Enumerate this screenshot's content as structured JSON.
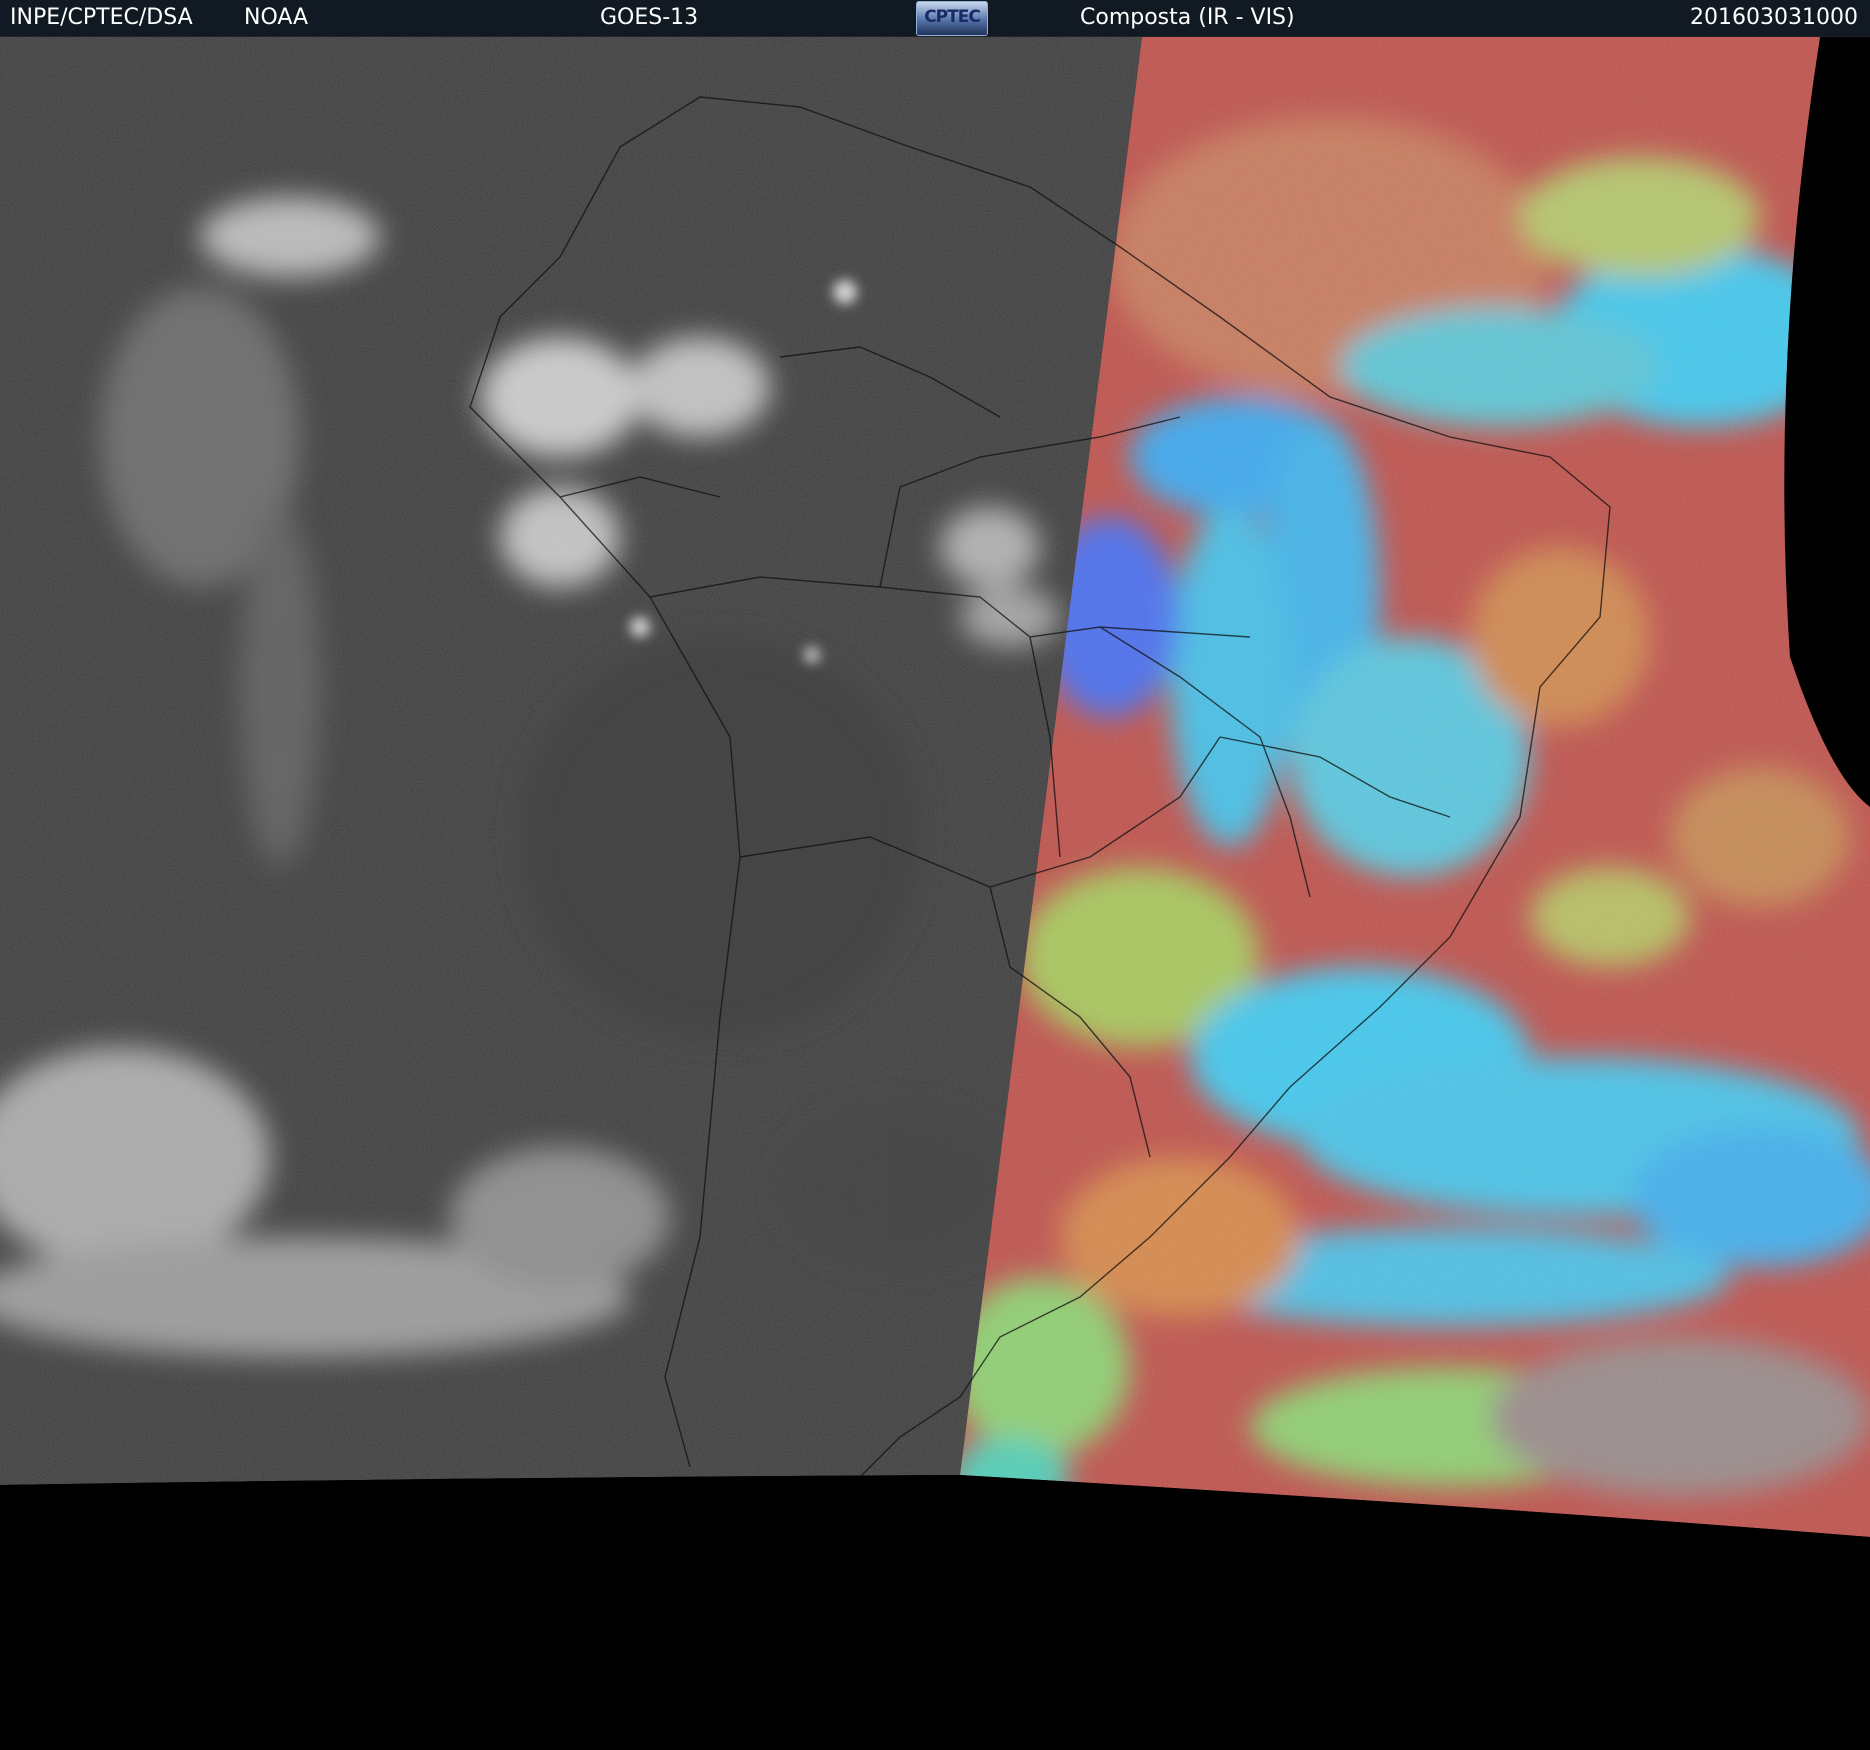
{
  "header": {
    "organization": "INPE/CPTEC/DSA",
    "agency": "NOAA",
    "satellite": "GOES-13",
    "logo_text": "CPTEC",
    "product": "Composta (IR - VIS)",
    "timestamp": "201603031000"
  },
  "colors": {
    "header_bg": "#111a22",
    "header_text": "#ffffff",
    "ir_dark": "#3a3a3a",
    "ir_cloud": "#dcdcdc",
    "vis_land_red": "#c0504a",
    "vis_cloud_cyan": "#3fc9f0",
    "vis_cloud_green": "#8fd070",
    "vis_cloud_blue": "#4a6ef0",
    "background": "#000000"
  }
}
